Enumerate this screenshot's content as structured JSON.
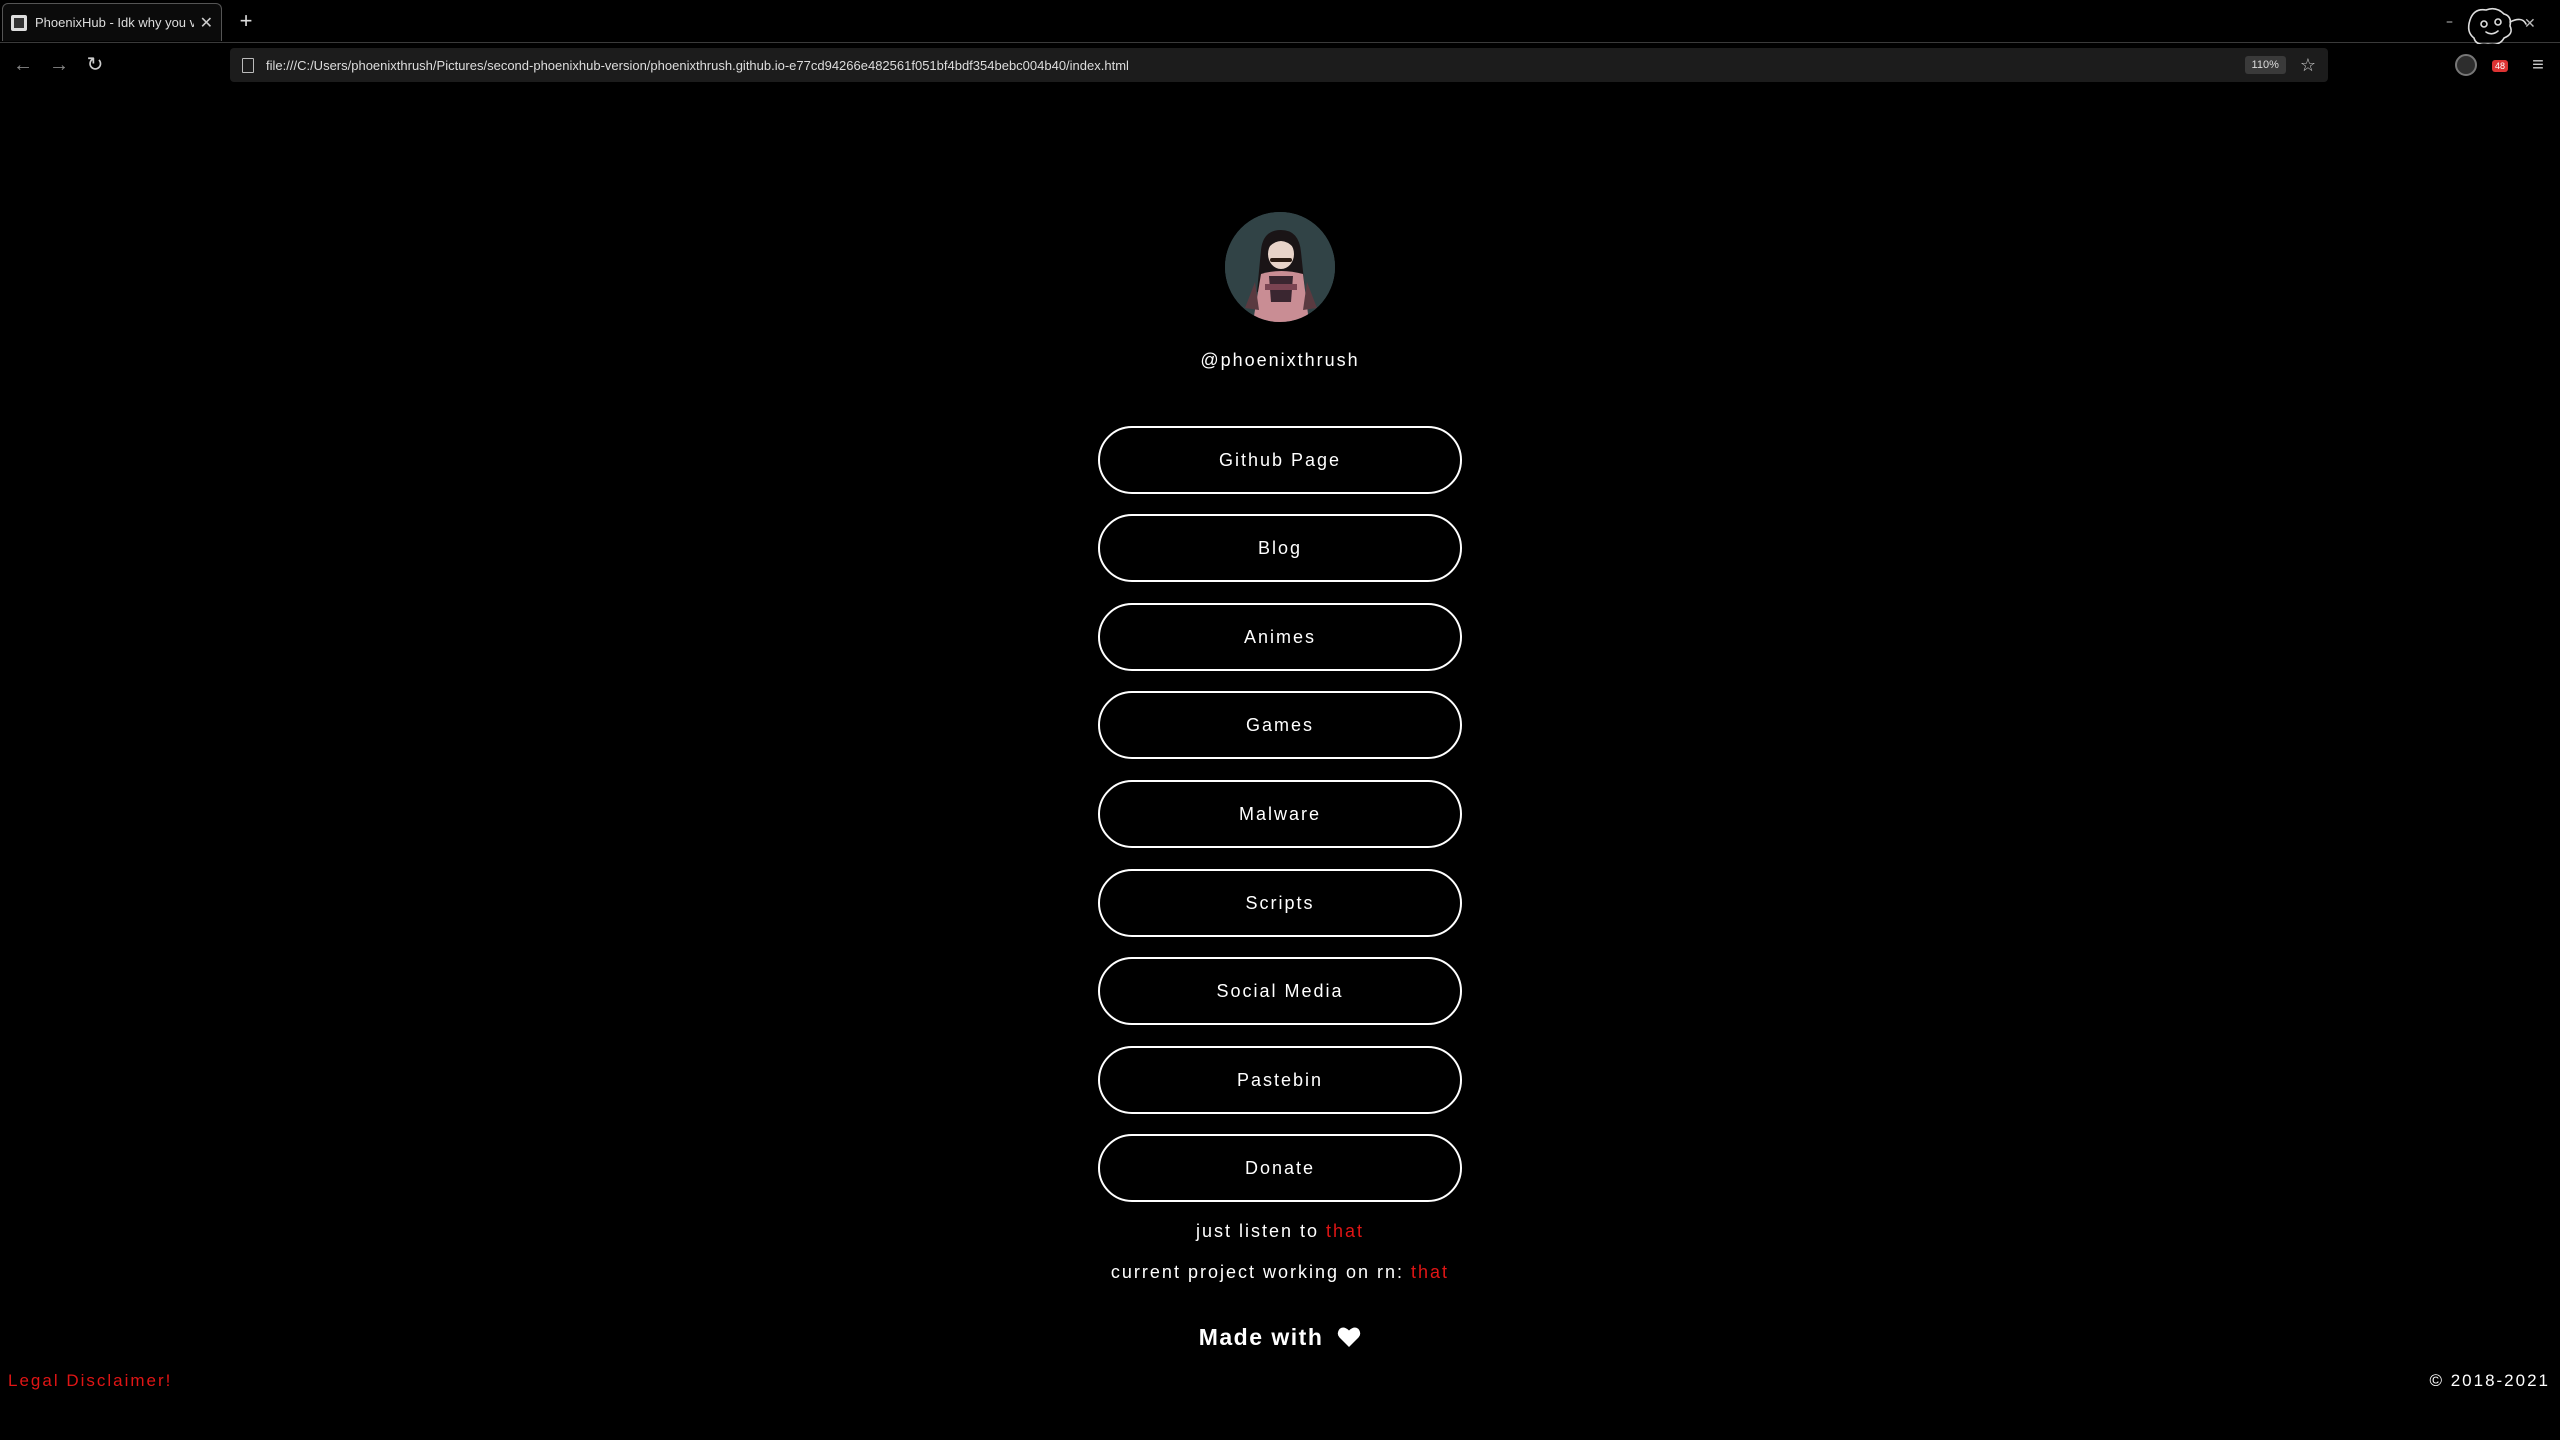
{
  "browser": {
    "tab_title": "PhoenixHub - Idk why you visit",
    "url": "file:///C:/Users/phoenixthrush/Pictures/second-phoenixhub-version/phoenixthrush.github.io-e77cd94266e482561f051bf4bdf354bebc004b40/index.html",
    "zoom": "110%",
    "extension_badge": "48"
  },
  "profile": {
    "handle": "@phoenixthrush"
  },
  "links": [
    {
      "label": "Github Page"
    },
    {
      "label": "Blog"
    },
    {
      "label": "Animes"
    },
    {
      "label": "Games"
    },
    {
      "label": "Malware"
    },
    {
      "label": "Scripts"
    },
    {
      "label": "Social Media"
    },
    {
      "label": "Pastebin"
    },
    {
      "label": "Donate"
    }
  ],
  "listen": {
    "text": "just listen to ",
    "link": "that"
  },
  "project": {
    "text": "current project working on rn: ",
    "link": "that"
  },
  "footer": {
    "made_with": "Made with",
    "disclaimer": "Legal Disclaimer!",
    "copyright": "© 2018-2021"
  },
  "colors": {
    "background": "#000000",
    "accent_red": "#e01515",
    "text": "#ffffff"
  }
}
